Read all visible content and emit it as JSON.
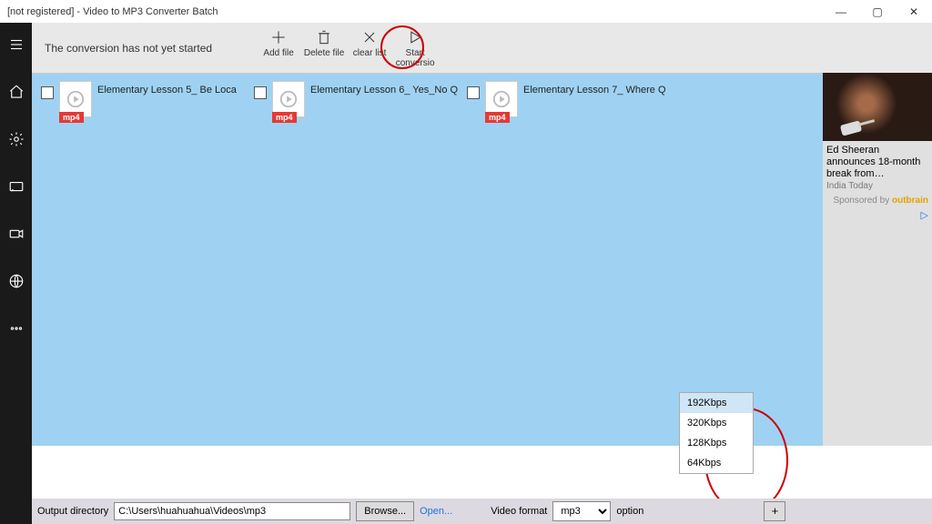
{
  "title": "[not registered] - Video to MP3 Converter Batch",
  "win_buttons": {
    "min": "—",
    "max": "▢",
    "close": "✕"
  },
  "sidebar": {
    "items": [
      {
        "name": "menu-icon"
      },
      {
        "name": "home-icon"
      },
      {
        "name": "settings-icon"
      },
      {
        "name": "caption-icon"
      },
      {
        "name": "video-icon"
      },
      {
        "name": "globe-icon"
      },
      {
        "name": "more-icon"
      }
    ]
  },
  "toolbar": {
    "status": "The conversion has not yet started",
    "add_file": "Add file",
    "delete_file": "Delete file",
    "clear_list": "clear list",
    "start": "Start conversio"
  },
  "files": [
    {
      "name": "Elementary Lesson 5_ Be   Loca",
      "tag": "mp4"
    },
    {
      "name": "Elementary Lesson 6_ Yes_No Q",
      "tag": "mp4"
    },
    {
      "name": "Elementary Lesson 7_ Where Q",
      "tag": "mp4"
    }
  ],
  "ad": {
    "headline": "Ed Sheeran announces 18-month break from…",
    "source": "India Today",
    "sponsored": "Sponsored by",
    "brand": "outbrain"
  },
  "bottom": {
    "outdir_label": "Output directory",
    "outdir_value": "C:\\Users\\huahuahua\\Videos\\mp3",
    "browse": "Browse...",
    "open": "Open...",
    "video_format_label": "Video format",
    "video_format_value": "mp3",
    "option_label": "option",
    "plus": "+",
    "bitrates": [
      "192Kbps",
      "320Kbps",
      "128Kbps",
      "64Kbps"
    ],
    "selected_bitrate_index": 0
  }
}
